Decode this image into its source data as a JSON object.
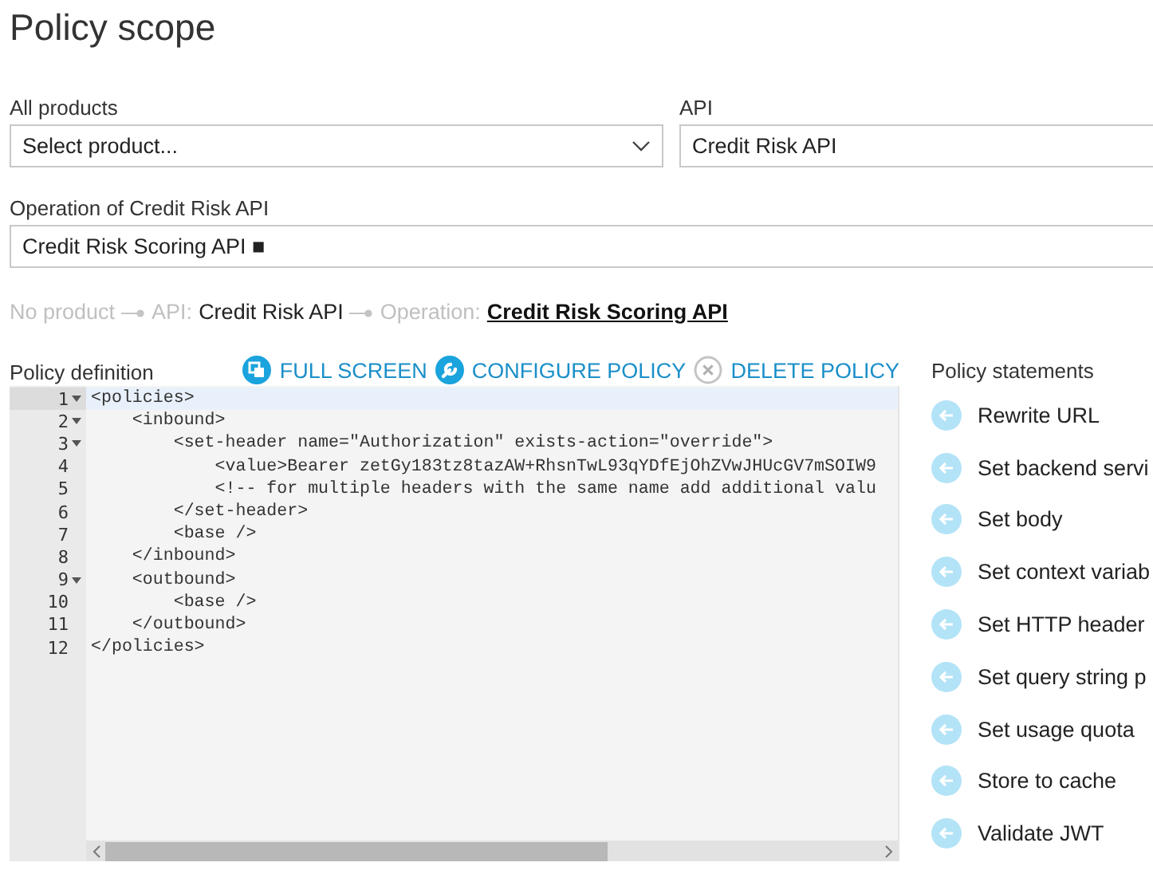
{
  "title": "Policy scope",
  "products": {
    "label": "All products",
    "placeholder": "Select product..."
  },
  "api": {
    "label": "API",
    "value": "Credit Risk API"
  },
  "operation": {
    "label": "Operation of Credit Risk API",
    "value": "Credit Risk Scoring API ■"
  },
  "breadcrumb": [
    {
      "kind": "plain",
      "text": "No product"
    },
    {
      "kind": "connector"
    },
    {
      "kind": "plain",
      "text": "API:"
    },
    {
      "kind": "value",
      "text": "Credit Risk API"
    },
    {
      "kind": "connector"
    },
    {
      "kind": "plain",
      "text": "Operation:"
    },
    {
      "kind": "link",
      "text": "Credit Risk Scoring API"
    }
  ],
  "policy_definition": {
    "label": "Policy definition",
    "actions": [
      {
        "kind": "fullscreen",
        "label": "FULL SCREEN"
      },
      {
        "kind": "configure",
        "label": "CONFIGURE POLICY"
      },
      {
        "kind": "delete",
        "label": "DELETE POLICY"
      }
    ],
    "lines": [
      {
        "number": "1",
        "text": "<policies>",
        "foldable": true,
        "current": true
      },
      {
        "number": "2",
        "text": "    <inbound>",
        "foldable": true,
        "current": false
      },
      {
        "number": "3",
        "text": "        <set-header name=\"Authorization\" exists-action=\"override\">",
        "foldable": true,
        "current": false
      },
      {
        "number": "4",
        "text": "            <value>Bearer zetGy183tz8tazAW+RhsnTwL93qYDfEjOhZVwJHUcGV7mSOIW9",
        "foldable": false,
        "current": false
      },
      {
        "number": "5",
        "text": "            <!-- for multiple headers with the same name add additional valu",
        "foldable": false,
        "current": false
      },
      {
        "number": "6",
        "text": "        </set-header>",
        "foldable": false,
        "current": false
      },
      {
        "number": "7",
        "text": "        <base />",
        "foldable": false,
        "current": false
      },
      {
        "number": "8",
        "text": "    </inbound>",
        "foldable": false,
        "current": false
      },
      {
        "number": "9",
        "text": "    <outbound>",
        "foldable": true,
        "current": false
      },
      {
        "number": "10",
        "text": "        <base />",
        "foldable": false,
        "current": false
      },
      {
        "number": "11",
        "text": "    </outbound>",
        "foldable": false,
        "current": false
      },
      {
        "number": "12",
        "text": "</policies>",
        "foldable": false,
        "current": false
      }
    ]
  },
  "policy_statements": {
    "label": "Policy statements",
    "items": [
      "Rewrite URL",
      "Set backend servi",
      "Set body",
      "Set context variab",
      "Set HTTP header",
      "Set query string p",
      "Set usage quota",
      "Store to cache",
      "Validate JWT"
    ]
  }
}
